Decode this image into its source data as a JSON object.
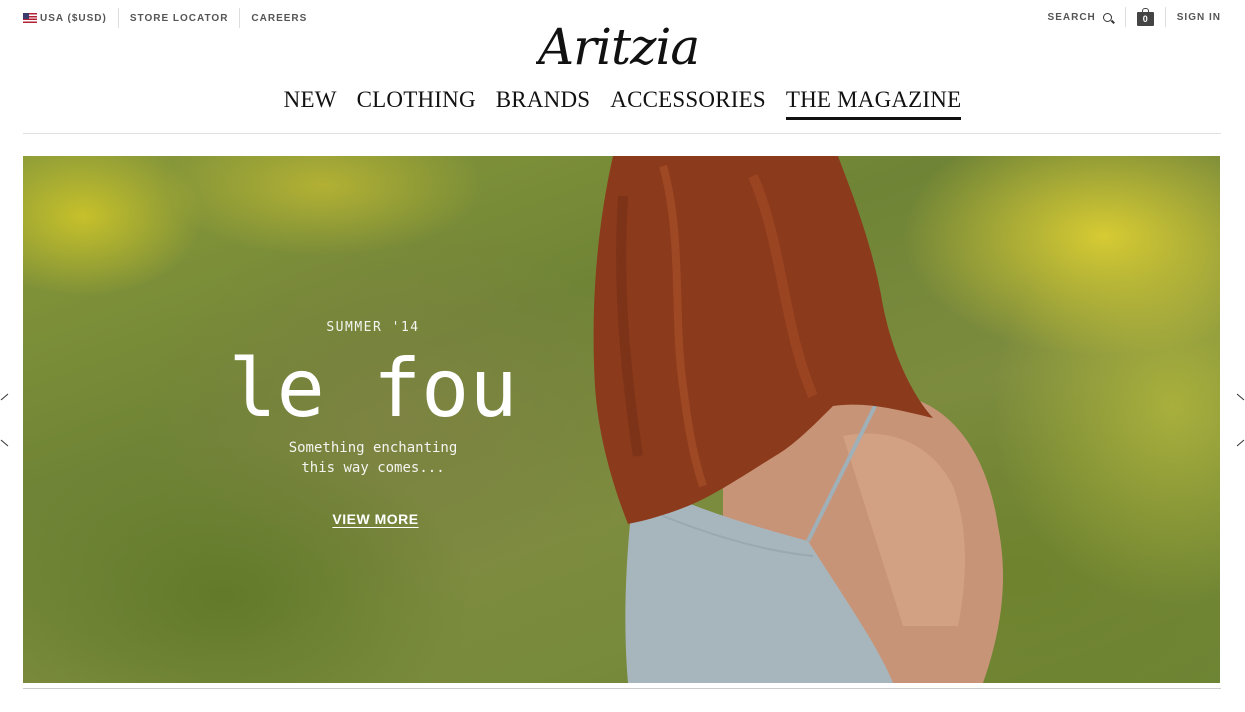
{
  "utility_left": {
    "region_label": "USA ($USD)",
    "store_locator": "STORE LOCATOR",
    "careers": "CAREERS"
  },
  "utility_right": {
    "search_label": "SEARCH",
    "bag_count": "0",
    "sign_in": "SIGN IN"
  },
  "logo_text": "Aritzia",
  "main_nav": [
    "NEW",
    "CLOTHING",
    "BRANDS",
    "ACCESSORIES",
    "THE MAGAZINE"
  ],
  "active_nav": "THE MAGAZINE",
  "hero": {
    "kicker": "SUMMER '14",
    "headline": "le fou",
    "subline_1": "Something enchanting",
    "subline_2": "this way comes...",
    "cta": "VIEW MORE"
  },
  "icons": [
    "us-flag-icon",
    "search-icon",
    "shopping-bag-icon",
    "chevron-left-icon",
    "chevron-right-icon"
  ],
  "colors": {
    "nav_text": "#111111",
    "hero_foliage": "#6f8436",
    "hair": "#8c3a1c",
    "dress": "#a8b8c0"
  }
}
